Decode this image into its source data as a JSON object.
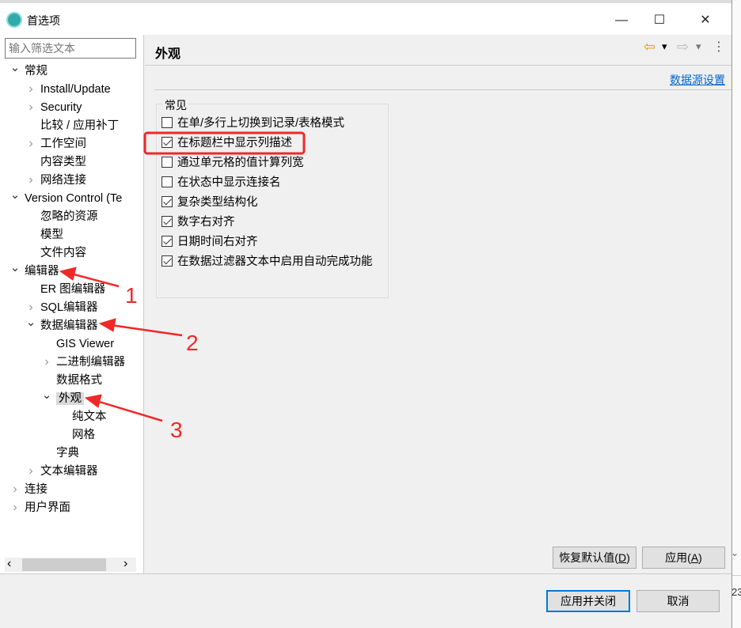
{
  "window": {
    "title": "首选项",
    "minimize": "—",
    "maximize": "☐",
    "close": "✕"
  },
  "filter": {
    "placeholder": "输入筛选文本"
  },
  "tree": [
    {
      "label": "常规",
      "level": 0,
      "chevron": "open"
    },
    {
      "label": "Install/Update",
      "level": 1,
      "chevron": "closed"
    },
    {
      "label": "Security",
      "level": 1,
      "chevron": "closed"
    },
    {
      "label": "比较 / 应用补丁",
      "level": 1,
      "chevron": "none"
    },
    {
      "label": "工作空间",
      "level": 1,
      "chevron": "closed"
    },
    {
      "label": "内容类型",
      "level": 1,
      "chevron": "none"
    },
    {
      "label": "网络连接",
      "level": 1,
      "chevron": "closed"
    },
    {
      "label": "Version Control (Te",
      "level": 0,
      "chevron": "open"
    },
    {
      "label": "忽略的资源",
      "level": 1,
      "chevron": "none"
    },
    {
      "label": "模型",
      "level": 1,
      "chevron": "none"
    },
    {
      "label": "文件内容",
      "level": 1,
      "chevron": "none"
    },
    {
      "label": "编辑器",
      "level": 0,
      "chevron": "open"
    },
    {
      "label": "ER 图编辑器",
      "level": 1,
      "chevron": "none"
    },
    {
      "label": "SQL编辑器",
      "level": 1,
      "chevron": "closed"
    },
    {
      "label": "数据编辑器",
      "level": 1,
      "chevron": "open"
    },
    {
      "label": "GIS Viewer",
      "level": 2,
      "chevron": "none"
    },
    {
      "label": "二进制编辑器",
      "level": 2,
      "chevron": "closed"
    },
    {
      "label": "数据格式",
      "level": 2,
      "chevron": "none"
    },
    {
      "label": "外观",
      "level": 2,
      "chevron": "open",
      "selected": true
    },
    {
      "label": "纯文本",
      "level": 3,
      "chevron": "none"
    },
    {
      "label": "网格",
      "level": 3,
      "chevron": "none"
    },
    {
      "label": "字典",
      "level": 2,
      "chevron": "none"
    },
    {
      "label": "文本编辑器",
      "level": 1,
      "chevron": "closed"
    },
    {
      "label": "连接",
      "level": 0,
      "chevron": "closed"
    },
    {
      "label": "用户界面",
      "level": 0,
      "chevron": "closed"
    }
  ],
  "scroll": {
    "left": "‹",
    "right": "›"
  },
  "page": {
    "title": "外观",
    "link": "数据源设置",
    "toolbar": {
      "back": "⇦",
      "forward": "⇨",
      "dropdown": "▾",
      "menu": "⋮"
    }
  },
  "group": {
    "label": "常见",
    "options": [
      {
        "label": "在单/多行上切换到记录/表格模式",
        "checked": false
      },
      {
        "label": "在标题栏中显示列描述",
        "checked": true
      },
      {
        "label": "通过单元格的值计算列宽",
        "checked": false
      },
      {
        "label": "在状态中显示连接名",
        "checked": false
      },
      {
        "label": "复杂类型结构化",
        "checked": true
      },
      {
        "label": "数字右对齐",
        "checked": true
      },
      {
        "label": "日期时间右对齐",
        "checked": true
      },
      {
        "label": "在数据过滤器文本中启用自动完成功能",
        "checked": true
      }
    ]
  },
  "buttons": {
    "restore_pre": "恢复默认值(",
    "restore_key": "D",
    "apply_pre": "应用(",
    "apply_key": "A",
    "close_paren": ")",
    "apply_close": "应用并关闭",
    "cancel": "取消"
  },
  "annotations": {
    "labels": [
      "1",
      "2",
      "3"
    ],
    "color": "#f02828"
  },
  "background": {
    "text": "23"
  }
}
